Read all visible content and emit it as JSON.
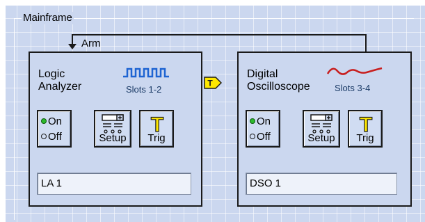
{
  "frame": {
    "title": "Mainframe"
  },
  "arm_label": "Arm",
  "trigger_connector": {
    "label": "T"
  },
  "modules": [
    {
      "name_line1": "Logic",
      "name_line2": "Analyzer",
      "slots": "Slots 1-2",
      "icon": "square-wave-icon",
      "on_label": "On",
      "off_label": "Off",
      "on_state": true,
      "setup_label": "Setup",
      "trig_label": "Trig",
      "trig_glyph": "T",
      "instance_name": "LA 1"
    },
    {
      "name_line1": "Digital",
      "name_line2": "Oscilloscope",
      "slots": "Slots 3-4",
      "icon": "sine-wave-icon",
      "on_label": "On",
      "off_label": "Off",
      "on_state": true,
      "setup_label": "Setup",
      "trig_label": "Trig",
      "trig_glyph": "T",
      "instance_name": "DSO 1"
    }
  ],
  "colors": {
    "background": "#cbd7ef",
    "square_wave": "#1e64d2",
    "sine_wave": "#c81e1e",
    "led_on": "#2dbb2d",
    "trig_yellow": "#ffe800"
  }
}
